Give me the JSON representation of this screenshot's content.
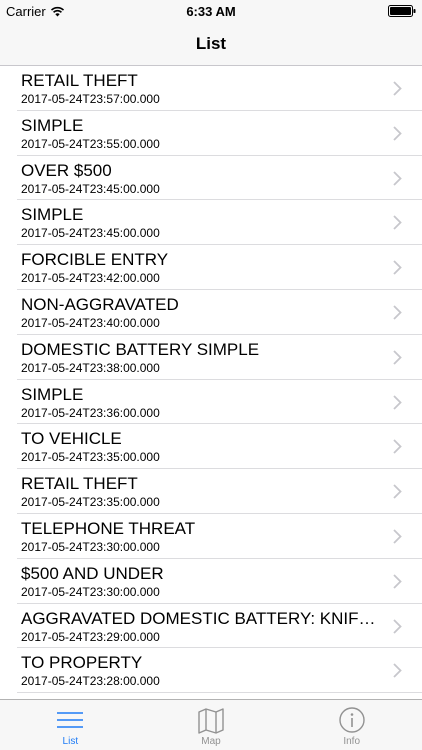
{
  "status_bar": {
    "carrier": "Carrier",
    "time": "6:33 AM"
  },
  "nav": {
    "title": "List"
  },
  "colors": {
    "accent": "#1f7cf6",
    "inactive": "#929292"
  },
  "rows": [
    {
      "title": "RETAIL THEFT",
      "date": "2017-05-24T23:57:00.000"
    },
    {
      "title": "SIMPLE",
      "date": "2017-05-24T23:55:00.000"
    },
    {
      "title": "OVER $500",
      "date": "2017-05-24T23:45:00.000"
    },
    {
      "title": "SIMPLE",
      "date": "2017-05-24T23:45:00.000"
    },
    {
      "title": "FORCIBLE ENTRY",
      "date": "2017-05-24T23:42:00.000"
    },
    {
      "title": "NON-AGGRAVATED",
      "date": "2017-05-24T23:40:00.000"
    },
    {
      "title": "DOMESTIC BATTERY SIMPLE",
      "date": "2017-05-24T23:38:00.000"
    },
    {
      "title": "SIMPLE",
      "date": "2017-05-24T23:36:00.000"
    },
    {
      "title": "TO VEHICLE",
      "date": "2017-05-24T23:35:00.000"
    },
    {
      "title": "RETAIL THEFT",
      "date": "2017-05-24T23:35:00.000"
    },
    {
      "title": "TELEPHONE THREAT",
      "date": "2017-05-24T23:30:00.000"
    },
    {
      "title": "$500 AND UNDER",
      "date": "2017-05-24T23:30:00.000"
    },
    {
      "title": "AGGRAVATED DOMESTIC BATTERY: KNIFE/CUTTING INSTR",
      "date": "2017-05-24T23:29:00.000"
    },
    {
      "title": "TO PROPERTY",
      "date": "2017-05-24T23:28:00.000"
    }
  ],
  "tabs": [
    {
      "label": "List",
      "icon": "list-icon",
      "active": true
    },
    {
      "label": "Map",
      "icon": "map-icon",
      "active": false
    },
    {
      "label": "Info",
      "icon": "info-icon",
      "active": false
    }
  ]
}
